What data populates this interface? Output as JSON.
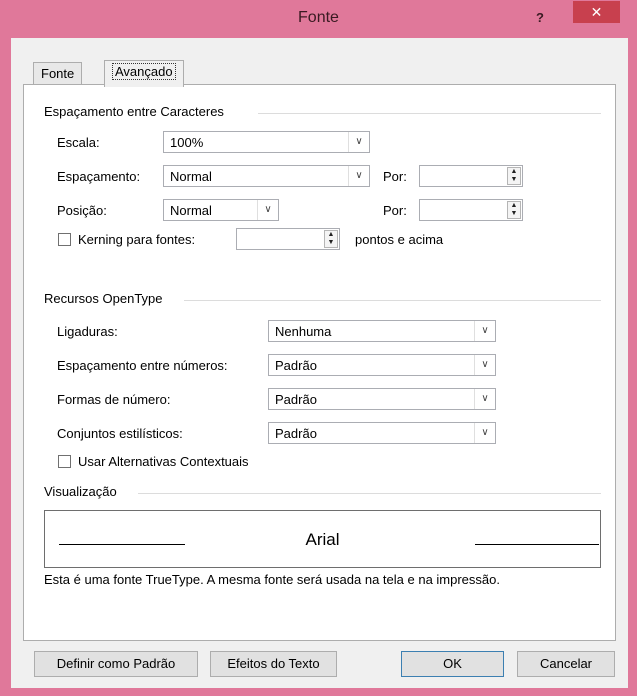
{
  "window": {
    "title": "Fonte",
    "help_label": "?",
    "close_label": "✕"
  },
  "tabs": [
    {
      "label": "Fonte",
      "accel": "F",
      "selected": false
    },
    {
      "label": "Avançado",
      "accel": "v",
      "selected": true
    }
  ],
  "char_spacing": {
    "group_label": "Espaçamento entre Caracteres",
    "scale": {
      "label": "Escala:",
      "value": "100%"
    },
    "spacing": {
      "label": "Espaçamento:",
      "value": "Normal",
      "by_label": "Por:",
      "by_value": ""
    },
    "position": {
      "label": "Posição:",
      "value": "Normal",
      "by_label": "Por:",
      "by_value": ""
    },
    "kerning": {
      "label": "Kerning para fontes:",
      "checked": false,
      "value": "",
      "suffix": "pontos e acima"
    }
  },
  "opentype": {
    "group_label": "Recursos OpenType",
    "ligatures": {
      "label": "Ligaduras:",
      "value": "Nenhuma"
    },
    "number_spacing": {
      "label": "Espaçamento entre números:",
      "value": "Padrão"
    },
    "number_forms": {
      "label": "Formas de número:",
      "value": "Padrão"
    },
    "stylistic_sets": {
      "label": "Conjuntos estilísticos:",
      "value": "Padrão"
    },
    "contextual_alternates": {
      "label": "Usar Alternativas Contextuais",
      "checked": false
    }
  },
  "preview": {
    "group_label": "Visualização",
    "sample_text": "Arial",
    "description": "Esta é uma fonte TrueType. A mesma fonte será usada na tela e na impressão."
  },
  "buttons": {
    "set_default": "Definir como Padrão",
    "text_effects": "Efeitos do Texto",
    "ok": "OK",
    "cancel": "Cancelar"
  },
  "icons": {
    "dropdown": "chevron-down-icon",
    "spinner": "spin-up-down-icon"
  },
  "colors": {
    "title_bar": "#e0789a",
    "close_button": "#c8404e",
    "dialog_bg": "#f0f0f0"
  }
}
